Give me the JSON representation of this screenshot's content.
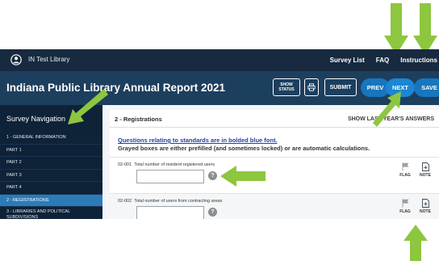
{
  "header": {
    "library_name": "IN Test Library",
    "links": [
      {
        "label": "Survey List"
      },
      {
        "label": "FAQ"
      },
      {
        "label": "Instructions"
      }
    ]
  },
  "report": {
    "title": "Indiana Public Library Annual Report 2021",
    "buttons": {
      "show_status": "SHOW STATUS",
      "submit": "SUBMIT",
      "prev": "PREV",
      "next": "NEXT",
      "save": "SAVE"
    }
  },
  "sidebar": {
    "title": "Survey Navigation",
    "items": [
      {
        "label": "1 - GENERAL INFORMATION"
      },
      {
        "label": "PART 1"
      },
      {
        "label": "PART 2"
      },
      {
        "label": "PART 3"
      },
      {
        "label": "PART 4"
      },
      {
        "label": "2 - REGISTRATIONS"
      },
      {
        "label": "3 - LIBRARIES AND POLITICAL SUBDIVISIONS"
      }
    ],
    "active_index": 5
  },
  "main": {
    "section_title": "2 - Registrations",
    "show_answers": "SHOW LAST YEAR'S ANSWERS",
    "note_standards": "Questions relating to standards are in bolded blue font.",
    "note_grayed": "Grayed boxes are either prefilled (and sometimes locked) or are automatic calculations.",
    "questions": [
      {
        "code": "02-001",
        "label": "Total number of resident registered users",
        "value": ""
      },
      {
        "code": "02-002",
        "label": "Total number of users from contracting areas",
        "value": ""
      }
    ],
    "flag_label": "FLAG",
    "note_label": "NOTE",
    "help_symbol": "?"
  },
  "colors": {
    "topbar": "#172a40",
    "titlebar": "#1d3f5e",
    "sidebar": "#0e2238",
    "active_item": "#2b7bb8",
    "pill_button": "#1776bd",
    "annotation_arrow": "#8dc63f",
    "standards_text": "#2340a6"
  },
  "icons": [
    "user-circle-icon",
    "print-icon",
    "help-icon",
    "flag-icon",
    "note-add-icon",
    "annotation-arrow-icon"
  ]
}
